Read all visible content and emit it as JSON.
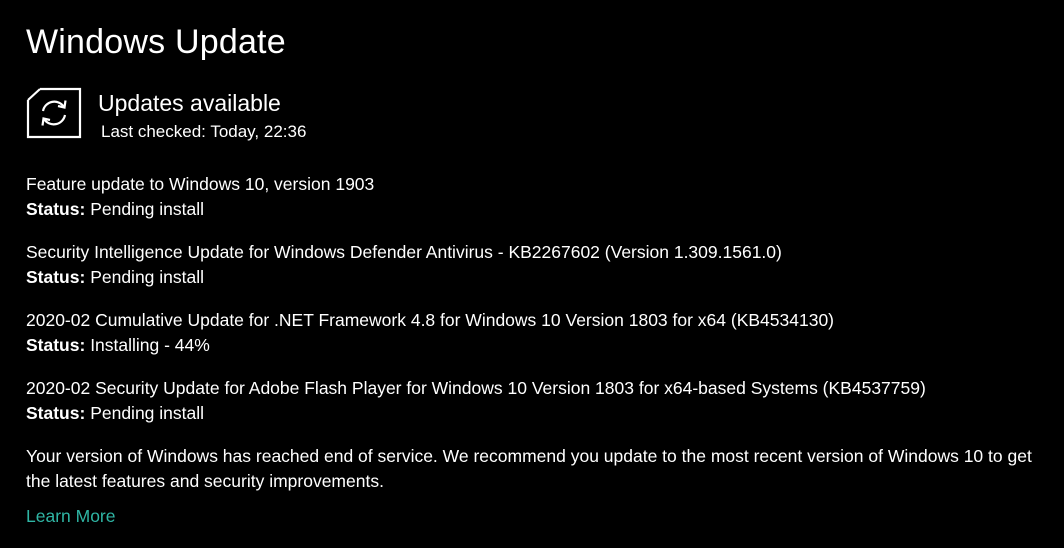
{
  "window": {
    "title": "Windows Update"
  },
  "header": {
    "icon": "refresh-icon",
    "title": "Updates available",
    "last_checked": "Last checked: Today, 22:36"
  },
  "status_label": "Status:",
  "updates": [
    {
      "name": "Feature update to Windows 10, version 1903",
      "status": "Pending install"
    },
    {
      "name": "Security Intelligence Update for Windows Defender Antivirus - KB2267602 (Version 1.309.1561.0)",
      "status": "Pending install"
    },
    {
      "name": "2020-02 Cumulative Update for .NET Framework 4.8 for Windows 10 Version 1803 for x64 (KB4534130)",
      "status": "Installing - 44%"
    },
    {
      "name": "2020-02 Security Update for Adobe Flash Player for Windows 10 Version 1803 for x64-based Systems (KB4537759)",
      "status": "Pending install"
    }
  ],
  "end_of_service": {
    "message": "Your version of Windows has reached end of service. We recommend you update to the most recent version of Windows 10 to get the latest features and security improvements.",
    "link_label": "Learn More"
  },
  "colors": {
    "background": "#000000",
    "text": "#ffffff",
    "link": "#2fb5a4"
  }
}
